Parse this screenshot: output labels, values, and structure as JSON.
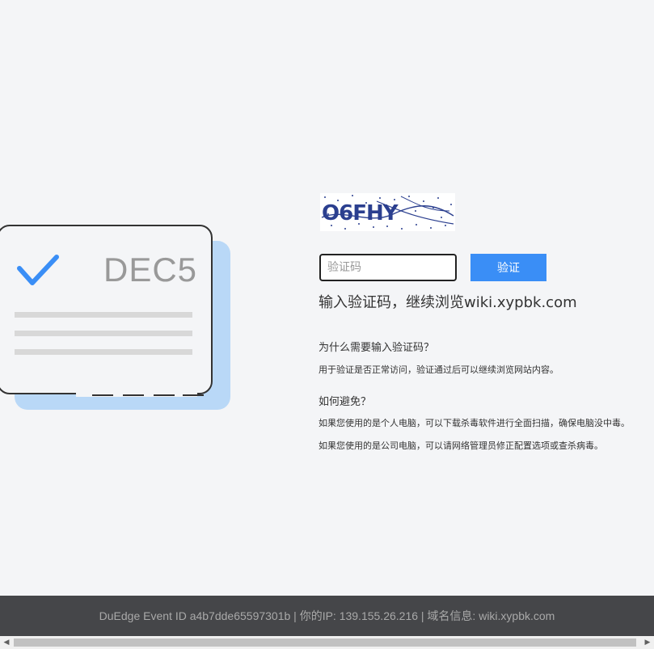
{
  "illustration": {
    "card_code": "DEC5"
  },
  "captcha": {
    "image_text": "O6FHY",
    "input_placeholder": "验证码",
    "input_value": "",
    "verify_label": "验证"
  },
  "prompt": "输入验证码，继续浏览wiki.xypbk.com",
  "faq": {
    "why_title": "为什么需要输入验证码？",
    "why_text": "用于验证是否正常访问，验证通过后可以继续浏览网站内容。",
    "avoid_title": "如何避免？",
    "avoid_text_1": "如果您使用的是个人电脑，可以下载杀毒软件进行全面扫描，确保电脑没中毒。",
    "avoid_text_2": "如果您使用的是公司电脑，可以请网络管理员修正配置选项或查杀病毒。"
  },
  "footer": {
    "text": "DuEdge Event ID a4b7dde65597301b | 你的IP: 139.155.26.216 | 域名信息: wiki.xypbk.com"
  },
  "colors": {
    "accent": "#3a8ef6",
    "card_shadow": "#b9d8f7",
    "footer_bg": "#454649"
  },
  "icons": {
    "check": "check-icon",
    "scroll_left": "chevron-left-icon",
    "scroll_right": "chevron-right-icon"
  }
}
